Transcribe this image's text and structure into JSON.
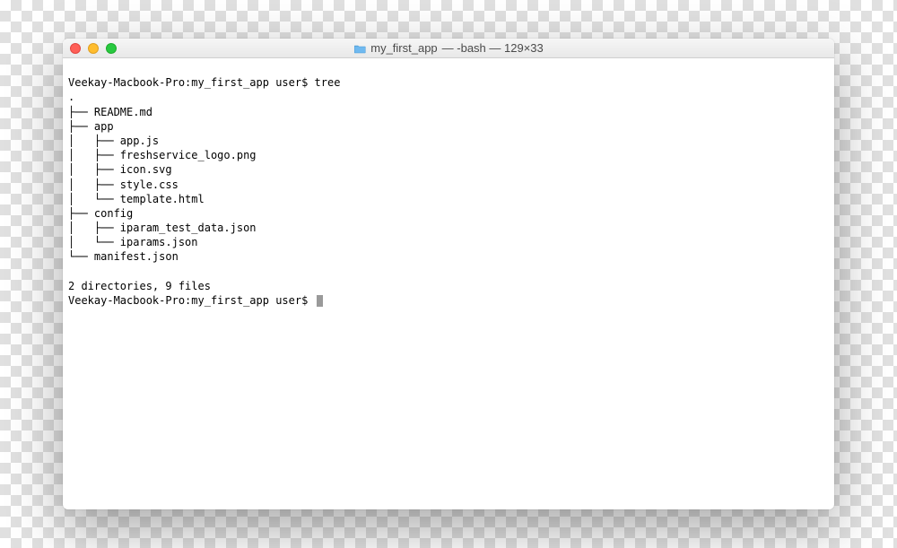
{
  "window": {
    "title_folder": "my_first_app",
    "title_suffix": " — -bash — 129×33"
  },
  "terminal": {
    "prompt1_prefix": "Veekay-Macbook-Pro:my_first_app user$ ",
    "prompt1_command": "tree",
    "tree_output": ".\n├── README.md\n├── app\n│   ├── app.js\n│   ├── freshservice_logo.png\n│   ├── icon.svg\n│   ├── style.css\n│   └── template.html\n├── config\n│   ├── iparam_test_data.json\n│   └── iparams.json\n└── manifest.json",
    "summary": "2 directories, 9 files",
    "prompt2_prefix": "Veekay-Macbook-Pro:my_first_app user$ "
  }
}
